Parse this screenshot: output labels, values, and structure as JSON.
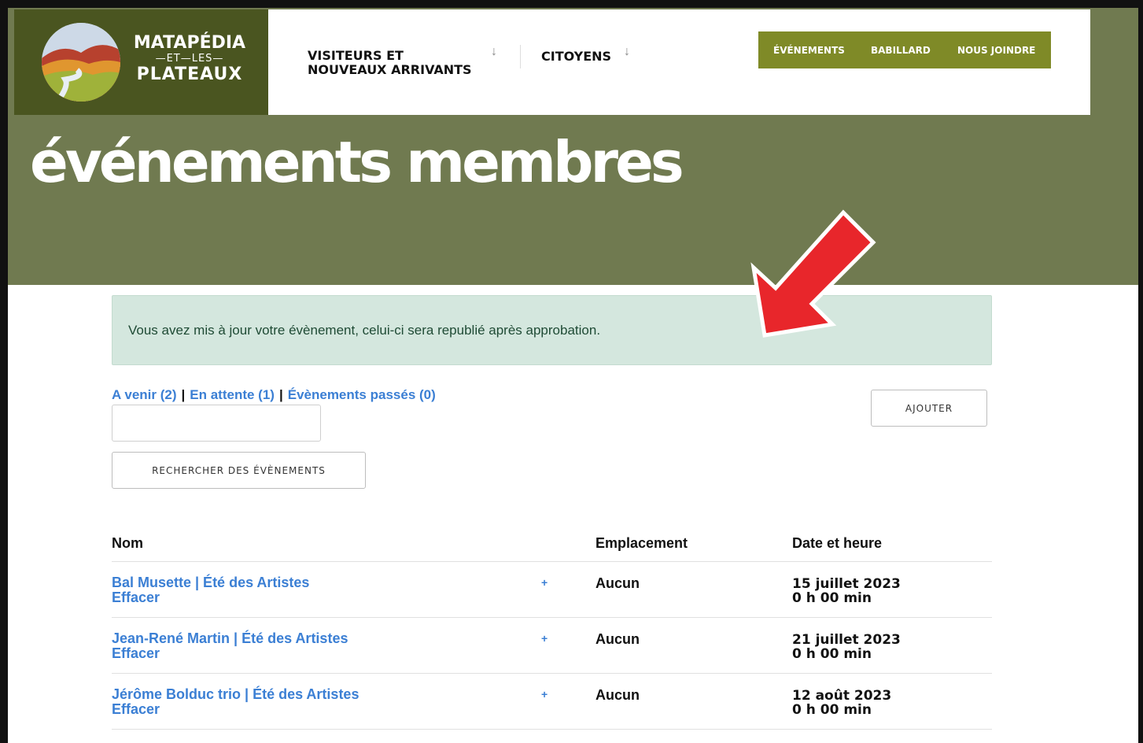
{
  "logo": {
    "line1": "MATAPÉDIA",
    "line2": "—ET—LES—",
    "line3": "PLATEAUX"
  },
  "nav": {
    "visitors_line1": "VISITEURS ET",
    "visitors_line2": "NOUVEAUX ARRIVANTS",
    "visitors_arrow": "↓",
    "citizens": "CITOYENS",
    "citizens_arrow": "↓"
  },
  "topnav": {
    "events": "ÉVÉNEMENTS",
    "board": "BABILLARD",
    "contact": "NOUS JOINDRE"
  },
  "hero": {
    "title": "événements membres"
  },
  "alert": {
    "message": "Vous avez mis à jour votre évènement, celui-ci sera republié après approbation."
  },
  "filters": {
    "upcoming": "A venir (2)",
    "pending": "En attente (1)",
    "past": "Évènements passés (0)",
    "separator": "|"
  },
  "search": {
    "placeholder": "",
    "button_label": "RECHERCHER DES ÉVÈNEMENTS"
  },
  "add_button": "AJOUTER",
  "table": {
    "headers": {
      "name": "Nom",
      "location": "Emplacement",
      "datetime": "Date et heure"
    },
    "rows": [
      {
        "name": "Bal Musette | Été des Artistes",
        "delete": "Effacer",
        "plus": "+",
        "location": "Aucun",
        "date": "15 juillet 2023",
        "time": "0 h 00 min"
      },
      {
        "name": "Jean-René Martin | Été des Artistes",
        "delete": "Effacer",
        "plus": "+",
        "location": "Aucun",
        "date": "21 juillet 2023",
        "time": "0 h 00 min"
      },
      {
        "name": "Jérôme Bolduc trio | Été des Artistes",
        "delete": "Effacer",
        "plus": "+",
        "location": "Aucun",
        "date": "12 août 2023",
        "time": "0 h 00 min"
      }
    ]
  },
  "colors": {
    "hero_green": "#707a50",
    "logo_bg": "#4a5520",
    "topnav_bg": "#7f8a27",
    "link_blue": "#3b7fd4",
    "alert_bg": "#d4e7de",
    "annotation_red": "#e8262b"
  }
}
